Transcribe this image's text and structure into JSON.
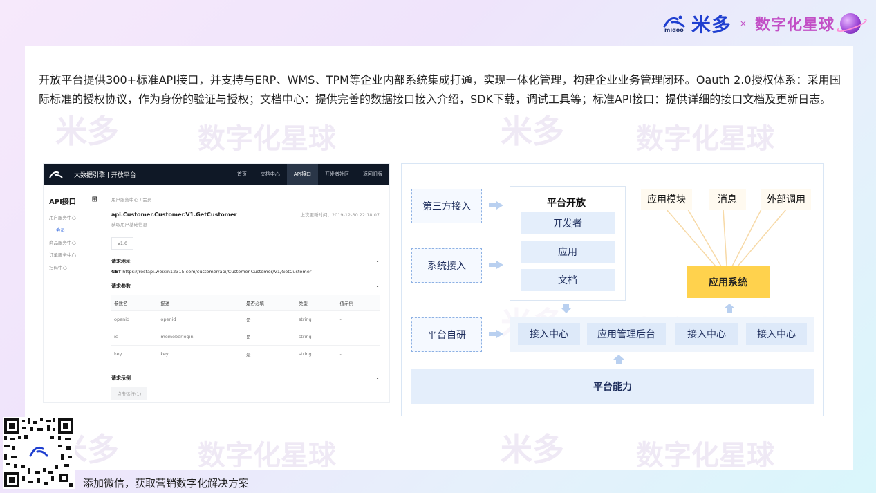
{
  "brand": {
    "midoo_small": "midoo",
    "midoo_cn": "米多",
    "separator": "×",
    "planet_cn": "数字化星球"
  },
  "watermark": {
    "brand_cn": "米多",
    "separator": "x",
    "planet_cn": "数字化星球"
  },
  "intro": "开放平台提供300+标准API接口，并支持与ERP、WMS、TPM等企业内部系统集成打通，实现一体化管理，构建企业业务管理闭环。Oauth 2.0授权体系：采用国际标准的授权协议，作为身份的验证与授权；文档中心：提供完善的数据接口接入介绍，SDK下载，调试工具等；标准API接口：提供详细的接口文档及更新日志。",
  "api_console": {
    "logo_text": "midoo",
    "title": "大数据引擎 | 开放平台",
    "nav": [
      "首页",
      "文档中心",
      "API接口",
      "开发者社区",
      "返回旧版"
    ],
    "nav_active_index": 2,
    "sidebar": {
      "heading": "API接口",
      "items": [
        "用户服务中心",
        "会员",
        "商品服务中心",
        "订单服务中心",
        "扫码中心"
      ],
      "selected_index": 1
    },
    "breadcrumb": "用户服务中心 / 会员",
    "method_name": "api.Customer.Customer.V1.GetCustomer",
    "updated": "上次更新时间：2019-12-30 22:18:07",
    "method_desc": "获取用户基础信息",
    "version": "v1.0",
    "request_url_heading": "请求地址",
    "request_method": "GET",
    "request_url": "https://restapi.weixin12315.com/customer/api/Customer.Customer/V1/GetCustomer",
    "params_heading": "请求参数",
    "params_columns": [
      "参数名",
      "描述",
      "是否必填",
      "类型",
      "值示例"
    ],
    "params_rows": [
      [
        "openid",
        "openid",
        "是",
        "string",
        "-"
      ],
      [
        "ic",
        "memeberlogin",
        "是",
        "string",
        "-"
      ],
      [
        "key",
        "key",
        "是",
        "string",
        "-"
      ]
    ],
    "example_heading": "请求示例",
    "try_button": "点击运行(1)"
  },
  "architecture": {
    "sources": [
      "第三方接入",
      "系统接入",
      "平台自研"
    ],
    "platform_open_title": "平台开放",
    "platform_open_items": [
      "开发者",
      "应用",
      "文档"
    ],
    "modules": [
      "应用模块",
      "消息",
      "外部调用"
    ],
    "app_system": "应用系统",
    "platform_row": [
      "接入中心",
      "应用管理后台",
      "接入中心",
      "接入中心"
    ],
    "capability": "平台能力"
  },
  "footer": {
    "text": "添加微信，获取营销数字化解决方案",
    "qr_logo_text": "midoo"
  },
  "colors": {
    "brand_blue": "#1f3fd0",
    "brand_pink": "#c24fc6",
    "app_system_yellow": "#ffd24d",
    "pill_blue": "#e4eefb",
    "nav_dark": "#0f1826"
  }
}
